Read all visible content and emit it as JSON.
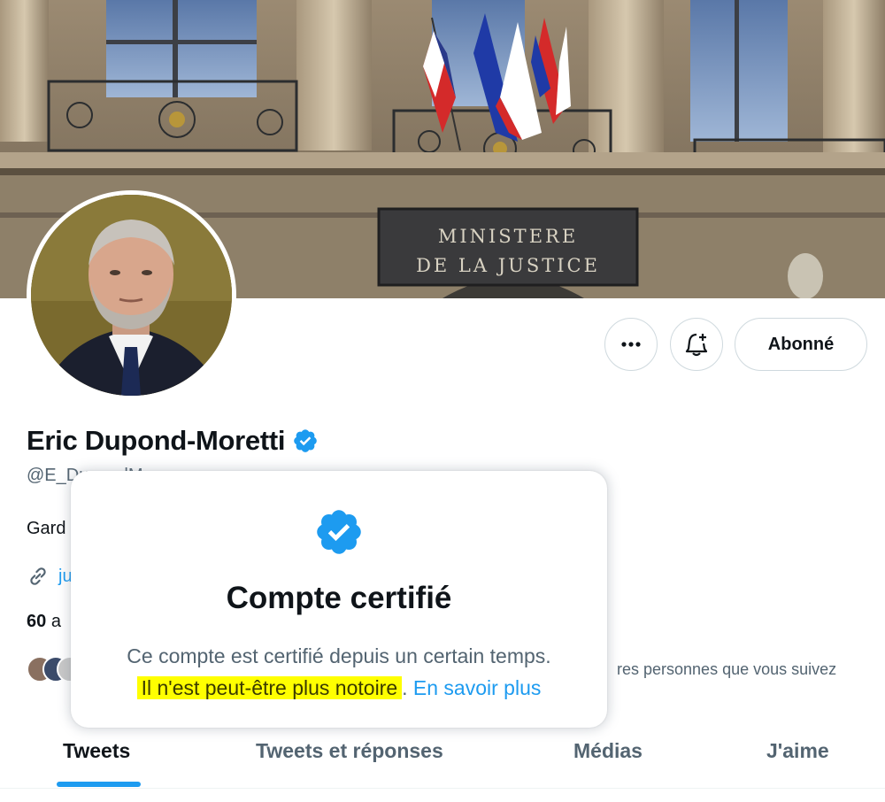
{
  "banner": {
    "plaque_line1": "MINISTERE",
    "plaque_line2": "DE LA JUSTICE"
  },
  "profile": {
    "display_name": "Eric Dupond-Moretti",
    "handle": "@E_DupondM",
    "bio_visible_start": "Gard",
    "link_visible_start": "ju",
    "stats_count": "60",
    "stats_visible_suffix": "a",
    "followers_known_text": "res personnes que vous suivez"
  },
  "actions": {
    "more_icon": "more-horizontal-icon",
    "notify_icon": "bell-plus-icon",
    "follow_label": "Abonné"
  },
  "popup": {
    "title": "Compte certifié",
    "line1": "Ce compte est certifié depuis un certain temps.",
    "highlight_text": "Il n'est peut-être plus notoire",
    "highlight_suffix": ".",
    "learn_more": "En savoir plus"
  },
  "tabs": [
    {
      "label": "Tweets",
      "active": true
    },
    {
      "label": "Tweets et réponses",
      "active": false
    },
    {
      "label": "Médias",
      "active": false
    },
    {
      "label": "J'aime",
      "active": false
    }
  ],
  "colors": {
    "accent": "#1d9bf0",
    "text": "#0f1419",
    "secondary_text": "#536471",
    "highlight": "#ffff00",
    "border": "#cfd9de"
  }
}
